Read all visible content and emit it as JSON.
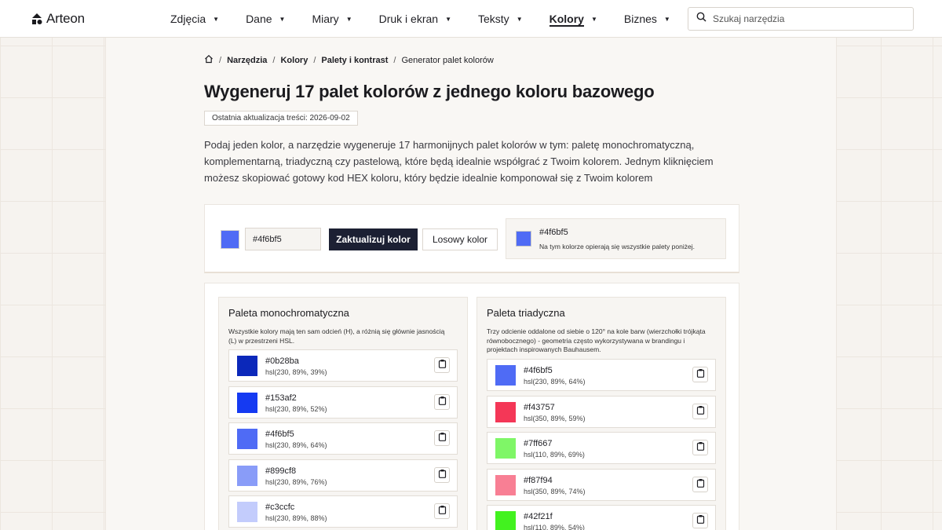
{
  "header": {
    "logo_text": "Arteon",
    "nav": [
      {
        "label": "Zdjęcia",
        "active": false
      },
      {
        "label": "Dane",
        "active": false
      },
      {
        "label": "Miary",
        "active": false
      },
      {
        "label": "Druk i ekran",
        "active": false
      },
      {
        "label": "Teksty",
        "active": false
      },
      {
        "label": "Kolory",
        "active": true
      },
      {
        "label": "Biznes",
        "active": false
      }
    ],
    "search_placeholder": "Szukaj narzędzia"
  },
  "breadcrumb": {
    "items": [
      "Narzędzia",
      "Kolory",
      "Palety i kontrast"
    ],
    "current": "Generator palet kolorów"
  },
  "page": {
    "title": "Wygeneruj 17 palet kolorów z jednego koloru bazowego",
    "updated": "Ostatnia aktualizacja treści: 2026-09-02",
    "intro": "Podaj jeden kolor, a narzędzie wygeneruje 17 harmonijnych palet kolorów w tym: paletę monochromatyczną, komplementarną, triadyczną czy pastelową, które będą idealnie współgrać z Twoim kolorem. Jednym kliknięciem możesz skopiować gotowy kod HEX koloru, który będzie idealnie komponował się z Twoim kolorem"
  },
  "picker": {
    "hex_value": "#4f6bf5",
    "swatch_color": "#4f6bf5",
    "update_label": "Zaktualizuj kolor",
    "random_label": "Losowy kolor",
    "base_hex": "#4f6bf5",
    "base_note": "Na tym kolorze opierają się wszystkie palety poniżej."
  },
  "palettes": [
    {
      "title": "Paleta monochromatyczna",
      "description": "Wszystkie kolory mają ten sam odcień (H), a różnią się głównie jasnością (L) w przestrzeni HSL.",
      "colors": [
        {
          "hex": "#0b28ba",
          "hsl": "hsl(230, 89%, 39%)"
        },
        {
          "hex": "#153af2",
          "hsl": "hsl(230, 89%, 52%)"
        },
        {
          "hex": "#4f6bf5",
          "hsl": "hsl(230, 89%, 64%)"
        },
        {
          "hex": "#899cf8",
          "hsl": "hsl(230, 89%, 76%)"
        },
        {
          "hex": "#c3ccfc",
          "hsl": "hsl(230, 89%, 88%)"
        }
      ]
    },
    {
      "title": "Paleta triadyczna",
      "description": "Trzy odcienie oddalone od siebie o 120° na kole barw (wierzchołki trójkąta równobocznego) - geometria często wykorzystywana w brandingu i projektach inspirowanych Bauhausem.",
      "colors": [
        {
          "hex": "#4f6bf5",
          "hsl": "hsl(230, 89%, 64%)"
        },
        {
          "hex": "#f43757",
          "hsl": "hsl(350, 89%, 59%)"
        },
        {
          "hex": "#7ff667",
          "hsl": "hsl(110, 89%, 69%)"
        },
        {
          "hex": "#f87f94",
          "hsl": "hsl(350, 89%, 74%)"
        },
        {
          "hex": "#42f21f",
          "hsl": "hsl(110, 89%, 54%)"
        }
      ]
    }
  ],
  "icons": {
    "home": "home-icon",
    "search": "search-icon",
    "copy": "clipboard-icon",
    "caret": "caret-down-icon"
  }
}
